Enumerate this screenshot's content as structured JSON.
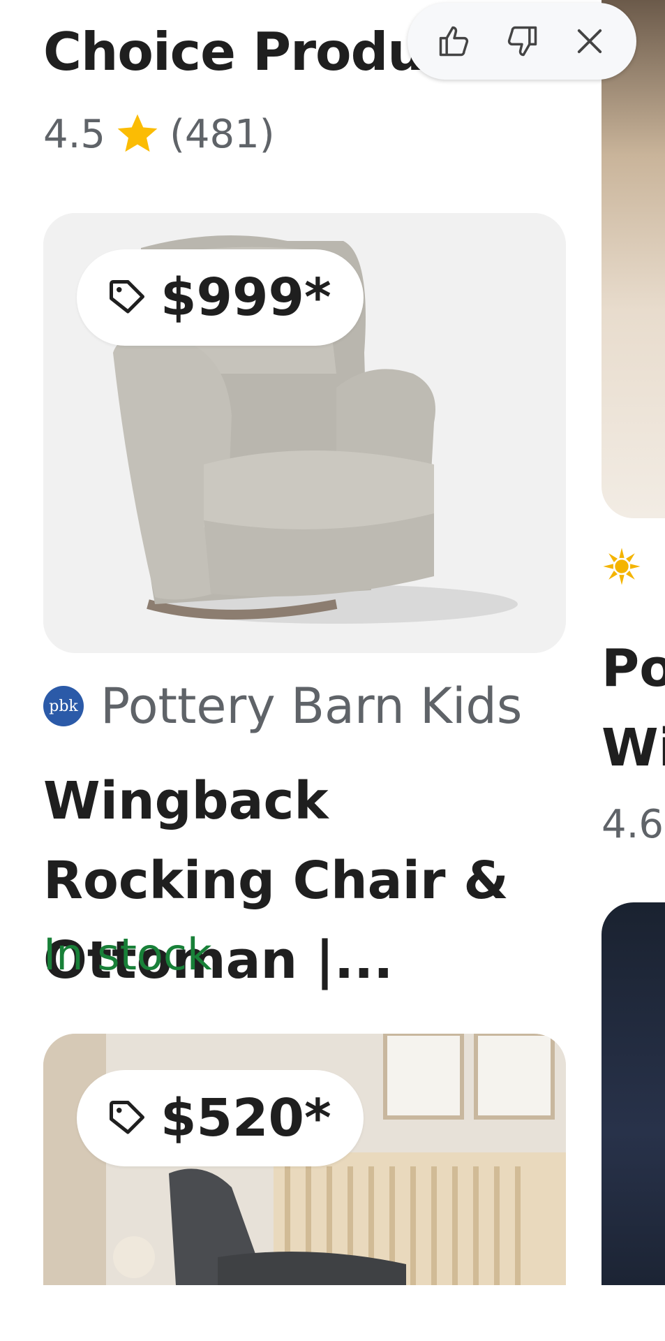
{
  "header": {
    "title": "Choice Products",
    "rating_value": "4.5",
    "rating_count": "(481)"
  },
  "feedback": {
    "thumbs_up_icon": "thumbs-up-icon",
    "thumbs_down_icon": "thumbs-down-icon",
    "close_icon": "close-icon"
  },
  "products": [
    {
      "price": "$999*",
      "merchant_logo_text": "pbk",
      "merchant": "Pottery Barn Kids",
      "name": "Wingback Rocking Chair & Ottoman |...",
      "availability": "In stock"
    },
    {
      "price": "$520*"
    }
  ],
  "next_card": {
    "title_partial": "Po\nWi",
    "rating_partial": "4.6"
  },
  "colors": {
    "star": "#fbbc04",
    "in_stock": "#188038",
    "pbk_logo": "#2b5aa8"
  }
}
